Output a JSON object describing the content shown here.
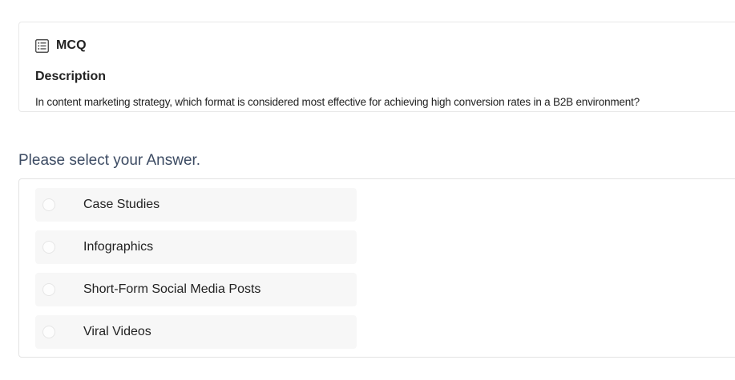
{
  "question": {
    "type_label": "MCQ",
    "description_heading": "Description",
    "description_text": "In content marketing strategy, which format is considered most effective for achieving high conversion rates in a B2B environment?"
  },
  "answer": {
    "prompt": "Please select your Answer.",
    "options": [
      {
        "label": "Case Studies",
        "selected": false
      },
      {
        "label": "Infographics",
        "selected": false
      },
      {
        "label": "Short-Form Social Media Posts",
        "selected": false
      },
      {
        "label": "Viral Videos",
        "selected": false
      }
    ]
  },
  "icons": {
    "question_type": "list-icon",
    "option_marker": "radio-icon"
  },
  "colors": {
    "prompt_text": "#3c4b63",
    "option_background": "#f7f7f7",
    "card_border": "#e8e8e8"
  }
}
